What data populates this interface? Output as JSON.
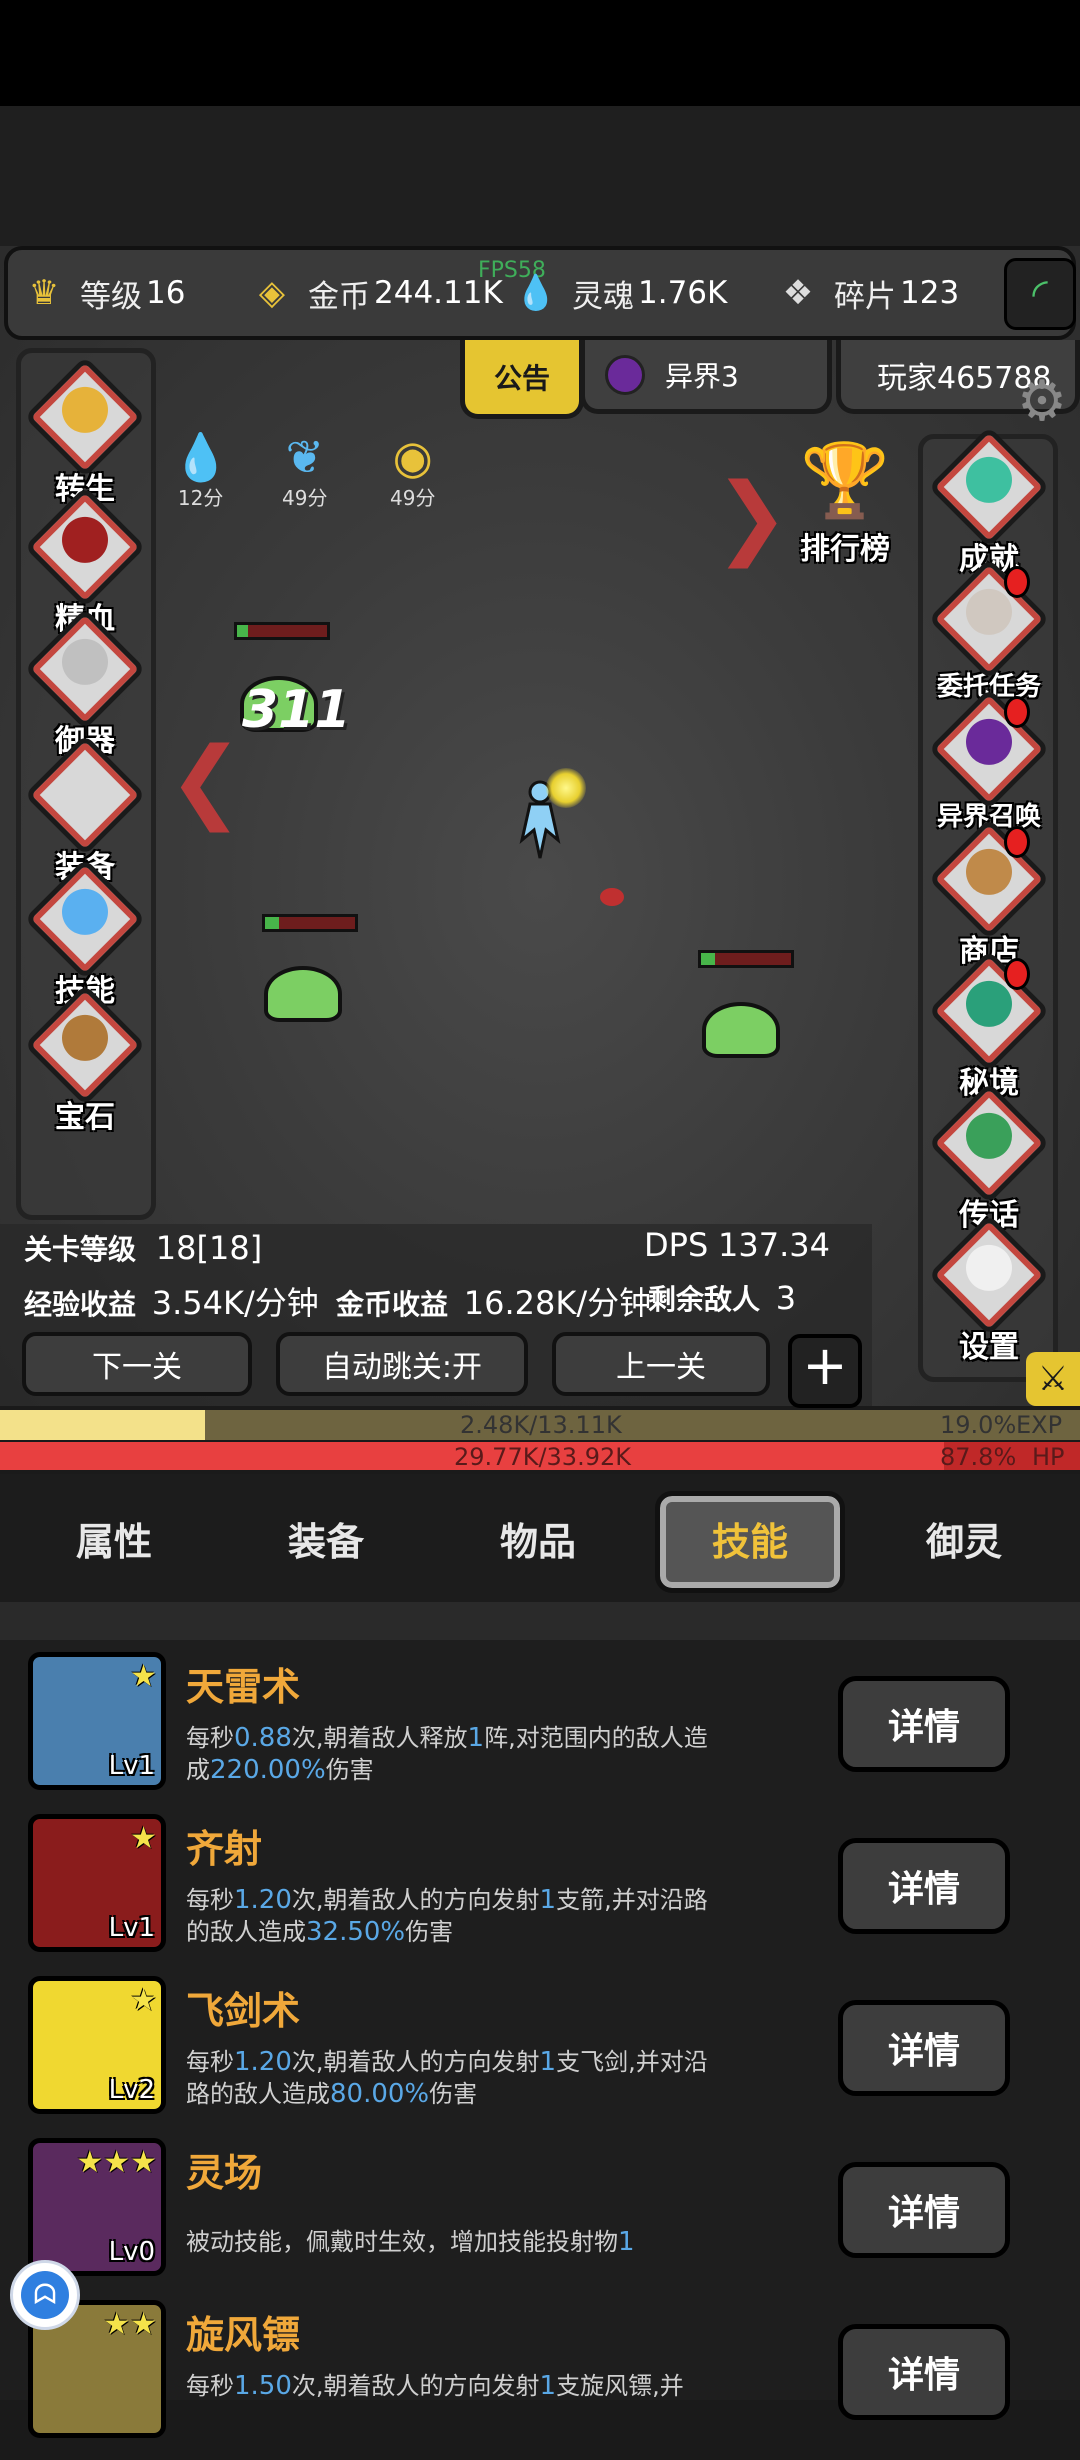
{
  "hud": {
    "level_label": "等级",
    "level_value": "16",
    "coin_label": "金币",
    "coin_value": "244.11K",
    "soul_label": "灵魂",
    "soul_value": "1.76K",
    "shard_label": "碎片",
    "shard_value": "123",
    "fps": "FPS58"
  },
  "top_tabs": {
    "notice": "公告",
    "other_world": "异界3",
    "player": "玩家465788"
  },
  "left_menu": [
    "转生",
    "精血",
    "御器",
    "装备",
    "技能",
    "宝石"
  ],
  "right_menu": [
    "成就",
    "委托任务",
    "异界召唤",
    "商店",
    "秘境",
    "传话",
    "设置"
  ],
  "leaderboard": "排行榜",
  "buffs": [
    "12分",
    "49分",
    "49分"
  ],
  "damage_text": "311",
  "stage": {
    "stage_label": "关卡等级",
    "stage_value": "18[18]",
    "dps_label": "DPS",
    "dps_value": "137.34",
    "exp_label": "经验收益",
    "exp_value": "3.54K/分钟",
    "gold_label": "金币收益",
    "gold_value": "16.28K/分钟",
    "enemy_label": "剩余敌人",
    "enemy_value": "3"
  },
  "buttons": {
    "next": "下一关",
    "auto_skip": "自动跳关:开",
    "prev": "上一关",
    "plus": "+"
  },
  "bars": {
    "exp_text": "2.48K/13.11K",
    "exp_percent": "19.0%",
    "exp_label": "EXP",
    "exp_fraction": 0.19,
    "hp_text": "29.77K/33.92K",
    "hp_percent": "87.8%",
    "hp_label": "HP"
  },
  "tabs": [
    "属性",
    "装备",
    "物品",
    "技能",
    "御灵"
  ],
  "skills": [
    {
      "name": "天雷术",
      "level": "Lv1",
      "stars": "★",
      "desc": [
        [
          "每秒",
          ""
        ],
        [
          "0.88",
          "n"
        ],
        [
          "次,朝着敌人释放",
          ""
        ],
        [
          "1",
          "n"
        ],
        [
          "阵,对范围内的敌人造成",
          ""
        ],
        [
          "220.00%",
          "n"
        ],
        [
          "伤害",
          ""
        ]
      ],
      "detail": "详情",
      "color": "#4a7fae"
    },
    {
      "name": "齐射",
      "level": "Lv1",
      "stars": "★",
      "desc": [
        [
          "每秒",
          ""
        ],
        [
          "1.20",
          "n"
        ],
        [
          "次,朝着敌人的方向发射",
          ""
        ],
        [
          "1",
          "n"
        ],
        [
          "支箭,并对沿路的敌人造成",
          ""
        ],
        [
          "32.50%",
          "n"
        ],
        [
          "伤害",
          ""
        ]
      ],
      "detail": "详情",
      "color": "#8a1c1c"
    },
    {
      "name": "飞剑术",
      "level": "Lv2",
      "stars": "★",
      "desc": [
        [
          "每秒",
          ""
        ],
        [
          "1.20",
          "n"
        ],
        [
          "次,朝着敌人的方向发射",
          ""
        ],
        [
          "1",
          "n"
        ],
        [
          "支飞剑,并对沿路的敌人造成",
          ""
        ],
        [
          "80.00%",
          "n"
        ],
        [
          "伤害",
          ""
        ]
      ],
      "detail": "详情",
      "color": "#f0d830"
    },
    {
      "name": "灵场",
      "level": "Lv0",
      "stars": "★★★",
      "desc": [
        [
          "被动技能，佩戴时生效，增加技能投射物",
          ""
        ],
        [
          "1",
          "n"
        ]
      ],
      "detail": "详情",
      "color": "#5a2a5e"
    },
    {
      "name": "旋风镖",
      "level": "",
      "stars": "★★",
      "desc": [
        [
          "每秒",
          ""
        ],
        [
          "1.50",
          "n"
        ],
        [
          "次,朝着敌人的方向发射",
          ""
        ],
        [
          "1",
          "n"
        ],
        [
          "支旋风镖,并",
          ""
        ]
      ],
      "detail": "详情",
      "color": "#8a7a3a"
    }
  ]
}
